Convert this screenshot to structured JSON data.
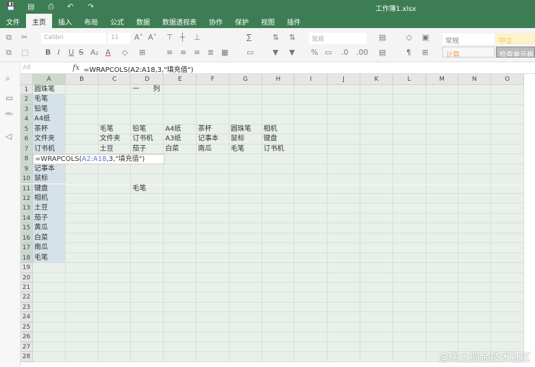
{
  "title": "工作簿1.xlsx",
  "menu": [
    "文件",
    "主页",
    "插入",
    "布局",
    "公式",
    "数据",
    "数据透视表",
    "协作",
    "保护",
    "视图",
    "插件"
  ],
  "active_menu": "主页",
  "toolbar": {
    "font": "Calibri",
    "size": "11",
    "number_format": "常规",
    "style_normal": "常规",
    "style_neutral": "中立",
    "style_calc": "计算",
    "style_check": "检查单元格"
  },
  "namebox": "A8",
  "formula": "=WRAPCOLS(A2:A18,3,\"填充值\")",
  "formula_parts": {
    "pre": "=WRAPCOLS(",
    "ref": "A2:A18",
    "post": ",3,\"填充值\")"
  },
  "columns": [
    "A",
    "B",
    "C",
    "D",
    "E",
    "F",
    "G",
    "H",
    "I",
    "J",
    "K",
    "L",
    "M",
    "N",
    "O"
  ],
  "row_count": 28,
  "cells": {
    "A1": "圆珠笔",
    "D1": "一　　列　　转　　多　　行",
    "A2": "毛笔",
    "A3": "铅笔",
    "A4": "A4纸",
    "A5": "茶杯",
    "A6": "文件夹",
    "A7": "订书机",
    "A9": "记事本",
    "A10": "鼠标",
    "A11": "键盘",
    "A12": "相机",
    "A13": "土豆",
    "A14": "茄子",
    "A15": "黄瓜",
    "A16": "白菜",
    "A17": "南瓜",
    "A18": "毛笔",
    "C5": "毛笔",
    "D5": "铅笔",
    "E5": "A4纸",
    "F5": "茶杯",
    "G5": "圆珠笔",
    "H5": "相机",
    "C6": "文件夹",
    "D6": "订书机",
    "E6": "A3纸",
    "F6": "记事本",
    "G6": "鼠标",
    "H6": "键盘",
    "C7": "土豆",
    "D7": "茄子",
    "E7": "白菜",
    "F7": "南瓜",
    "G7": "毛笔",
    "H7": "订书机",
    "D11": "毛笔"
  },
  "watermark": "@稀土掘金技术社区"
}
